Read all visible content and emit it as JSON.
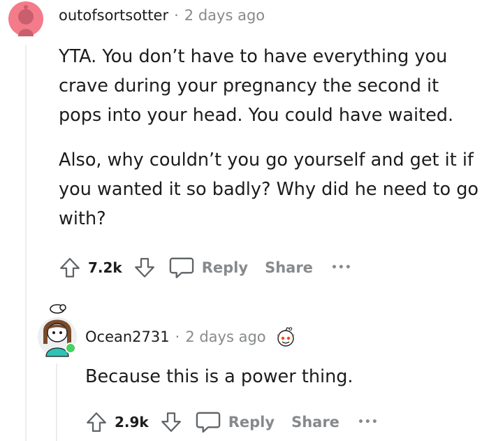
{
  "comments": [
    {
      "username": "outofsortsotter",
      "separator": "·",
      "timestamp": "2 days ago",
      "paragraphs": [
        "YTA. You don’t have to have everything you crave during your pregnancy the second it pops into your head. You could have waited.",
        "Also, why couldn’t you go yourself and get it if you wanted it so badly? Why did he need to go with?"
      ],
      "votes": "7.2k",
      "reply_label": "Reply",
      "share_label": "Share",
      "more_label": "•••",
      "avatar_color": "#f47b8a"
    },
    {
      "username": "Ocean2731",
      "separator": "·",
      "timestamp": "2 days ago",
      "paragraphs": [
        "Because this is a power thing."
      ],
      "votes": "2.9k",
      "reply_label": "Reply",
      "share_label": "Share",
      "more_label": "•••",
      "online_color": "#46d160"
    }
  ]
}
